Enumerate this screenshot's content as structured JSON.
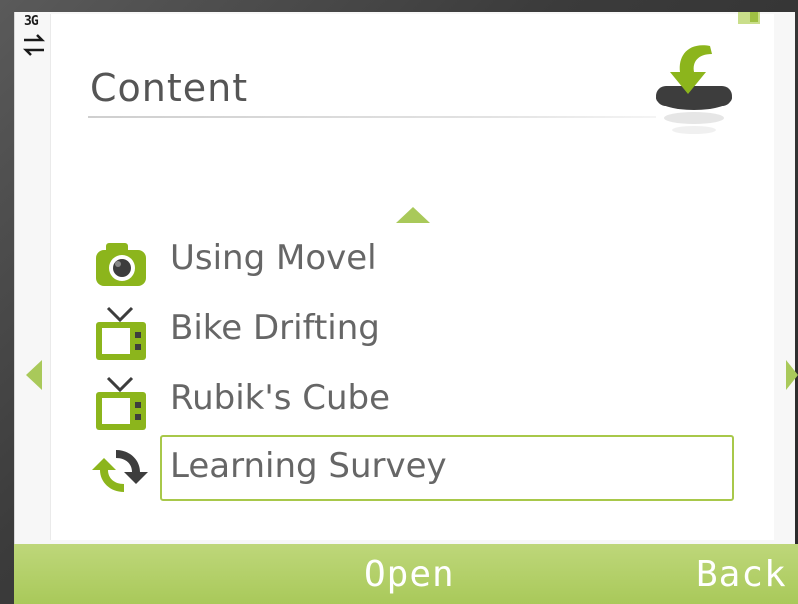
{
  "status": {
    "network": "3G"
  },
  "header": {
    "title": "Content"
  },
  "list": {
    "items": [
      {
        "label": "Using Movel",
        "icon": "camera-icon"
      },
      {
        "label": "Bike Drifting",
        "icon": "tv-icon"
      },
      {
        "label": "Rubik's Cube",
        "icon": "tv-icon"
      },
      {
        "label": "Learning Survey",
        "icon": "sync-icon",
        "selected": true
      }
    ]
  },
  "softkeys": {
    "left": "Open",
    "right": "Back"
  },
  "colors": {
    "accent": "#a9c95a",
    "icon_green": "#8cb51c",
    "text": "#666666"
  }
}
